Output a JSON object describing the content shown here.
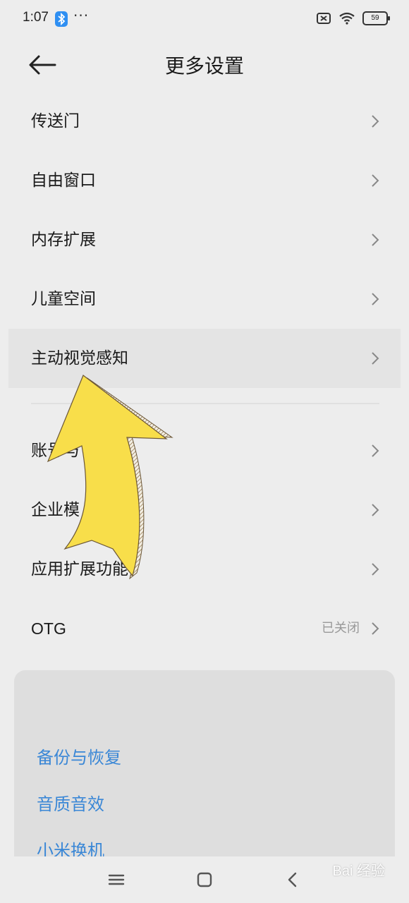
{
  "status": {
    "time": "1:07",
    "dots": "···",
    "battery": "59"
  },
  "header": {
    "title": "更多设置"
  },
  "items": [
    {
      "label": "传送门"
    },
    {
      "label": "自由窗口"
    },
    {
      "label": "内存扩展"
    },
    {
      "label": "儿童空间"
    },
    {
      "label": "主动视觉感知"
    },
    {
      "label": "账号与"
    },
    {
      "label": "企业模"
    },
    {
      "label": "应用扩展功能"
    },
    {
      "label": "OTG",
      "value": "已关闭"
    }
  ],
  "card": {
    "items": [
      "备份与恢复",
      "音质音效",
      "小米换机"
    ]
  },
  "watermark": "Bai 经验",
  "colors": {
    "background": "#ededed",
    "link_blue": "#3a87d6",
    "arrow_yellow": "#f8de4a"
  }
}
